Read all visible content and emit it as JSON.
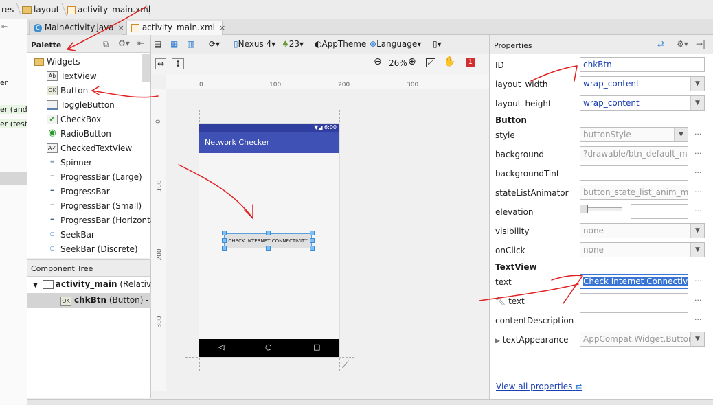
{
  "breadcrumb": {
    "items": [
      "res",
      "layout",
      "activity_main.xml"
    ]
  },
  "tabs": [
    {
      "label": "MainActivity.java",
      "close": "×"
    },
    {
      "label": "activity_main.xml",
      "close": "×"
    }
  ],
  "left_strip": {
    "items": [
      "er",
      "er (andr",
      "er (test)"
    ]
  },
  "palette": {
    "title": "Palette",
    "group": "Widgets",
    "items": [
      {
        "label": "TextView",
        "icon": "Ab"
      },
      {
        "label": "Button",
        "icon": "OK"
      },
      {
        "label": "ToggleButton",
        "icon": ""
      },
      {
        "label": "CheckBox",
        "icon": "✔"
      },
      {
        "label": "RadioButton",
        "icon": "◉"
      },
      {
        "label": "CheckedTextView",
        "icon": "A✓"
      },
      {
        "label": "Spinner",
        "icon": "≡"
      },
      {
        "label": "ProgressBar (Large)",
        "icon": "━"
      },
      {
        "label": "ProgressBar",
        "icon": "━"
      },
      {
        "label": "ProgressBar (Small)",
        "icon": "━"
      },
      {
        "label": "ProgressBar (Horizontal)",
        "icon": "━"
      },
      {
        "label": "SeekBar",
        "icon": "○"
      },
      {
        "label": "SeekBar (Discrete)",
        "icon": "○"
      }
    ]
  },
  "component_tree": {
    "title": "Component Tree",
    "root_bold": "activity_main",
    "root_rest": " (RelativeLa",
    "child_bold": "chkBtn",
    "child_rest": " (Button) - \"C"
  },
  "toolbar": {
    "device": "Nexus 4",
    "api": "23",
    "theme": "AppTheme",
    "language": "Language",
    "zoom": "26%",
    "error_count": "1"
  },
  "rulers": {
    "h": [
      "0",
      "100",
      "200",
      "300"
    ],
    "v": [
      "0",
      "100",
      "200",
      "300"
    ]
  },
  "device": {
    "time": "6:00",
    "app_title": "Network Checker",
    "button_text": "CHECK INTERNET CONNECTIVITY"
  },
  "properties": {
    "title": "Properties",
    "rows": [
      {
        "label": "ID",
        "value": "chkBtn"
      },
      {
        "label": "layout_width",
        "value": "wrap_content"
      },
      {
        "label": "layout_height",
        "value": "wrap_content"
      }
    ],
    "section_button": "Button",
    "button_rows": [
      {
        "label": "style",
        "value": "buttonStyle"
      },
      {
        "label": "background",
        "value": "?drawable/btn_default_mate"
      },
      {
        "label": "backgroundTint",
        "value": ""
      },
      {
        "label": "stateListAnimator",
        "value": "button_state_list_anim_mate"
      },
      {
        "label": "elevation",
        "value": ""
      },
      {
        "label": "visibility",
        "value": "none"
      },
      {
        "label": "onClick",
        "value": "none"
      }
    ],
    "section_textview": "TextView",
    "text_rows": [
      {
        "label": "text",
        "value": "Check Internet Connectivity"
      },
      {
        "label": "text",
        "value": ""
      },
      {
        "label": "contentDescription",
        "value": ""
      },
      {
        "label": "textAppearance",
        "value": "AppCompat.Widget.Button"
      }
    ],
    "view_all": "View all properties"
  },
  "colors": {
    "accent": "#3f51b5",
    "status": "#303f9f",
    "annotation": "#e02020"
  }
}
